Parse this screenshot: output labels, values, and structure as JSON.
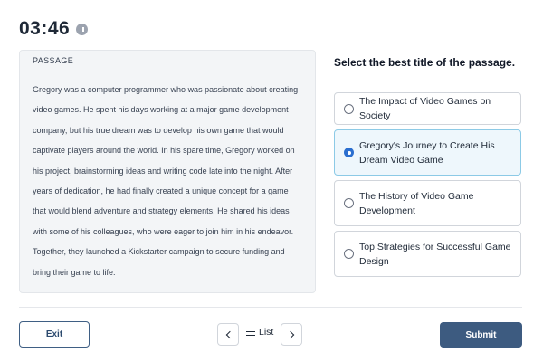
{
  "timer": {
    "value": "03:46"
  },
  "passage": {
    "header": "PASSAGE",
    "text": "Gregory was a computer programmer who was passionate about creating video games. He spent his days working at a major game development company, but his true dream was to develop his own game that would captivate players around the world. In his spare time, Gregory worked on his project, brainstorming ideas and writing code late into the night. After years of dedication, he had finally created a unique concept for a game that would blend adventure and strategy elements. He shared his ideas with some of his colleagues, who were eager to join him in his endeavor. Together, they launched a Kickstarter campaign to secure funding and bring their game to life."
  },
  "question": {
    "prompt": "Select the best title of the passage."
  },
  "options": [
    {
      "label": "The Impact of Video Games on Society",
      "selected": false
    },
    {
      "label": "Gregory's Journey to Create His Dream Video Game",
      "selected": true
    },
    {
      "label": "The History of Video Game Development",
      "selected": false
    },
    {
      "label": "Top Strategies for Successful Game Design",
      "selected": false
    }
  ],
  "footer": {
    "exit_label": "Exit",
    "list_label": "List",
    "submit_label": "Submit"
  },
  "colors": {
    "accent": "#2b6fcf",
    "selected_bg": "#eef7fc",
    "submit_bg": "#3d5b80"
  },
  "icons": {
    "pause": "pause-icon",
    "prev": "chevron-left-icon",
    "next": "chevron-right-icon",
    "list": "list-icon"
  }
}
